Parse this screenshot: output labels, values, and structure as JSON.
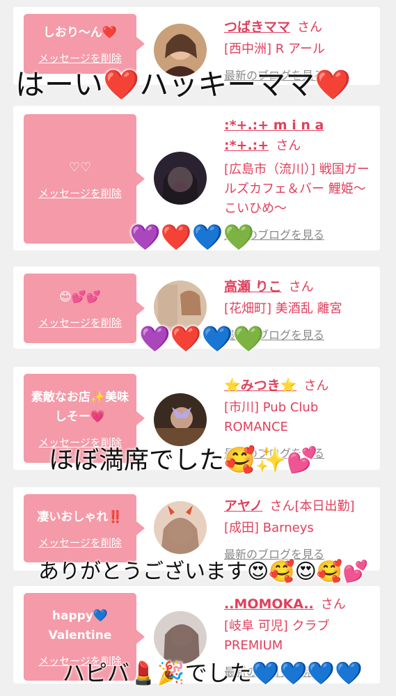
{
  "cards": [
    {
      "message": "しおり〜ん❤️",
      "delete_label": "メッセージを削除",
      "name": "つばきママ",
      "honorific": "さん",
      "shop": "[西中洲] R アール",
      "blog_label": "最新のブログを見る"
    },
    {
      "message": "♡♡",
      "delete_label": "メッセージを削除",
      "name": ":*+.:+ m i n a :*+.:+",
      "honorific": "さん",
      "shop": "[広島市（流川）] 戦国ガールズカフェ＆バー 鯉姫〜こいひめ〜",
      "blog_label": "最新のブログを見る"
    },
    {
      "message": "😊💕💕",
      "delete_label": "メッセージを削除",
      "name": "高瀬 りこ",
      "honorific": "さん",
      "shop": "[花畑町] 美酒乱 離宮",
      "blog_label": "最新のブログを見る"
    },
    {
      "message": "素敵なお店✨美味しそー💗",
      "delete_label": "メッセージを削除",
      "name": "⭐みつき⭐",
      "honorific": "さん",
      "shop": "[市川] Pub Club ROMANCE",
      "blog_label": "最新のブログを見る"
    },
    {
      "message": "凄いおしゃれ‼️",
      "delete_label": "メッセージを削除",
      "name": "アヤノ",
      "honorific": "さん[本日出勤]",
      "shop": "[成田] Barneys",
      "blog_label": "最新のブログを見る"
    },
    {
      "message": "happy💙 Valentine",
      "delete_label": "メッセージを削除",
      "name": "..MOMOKA..",
      "honorific": "さん",
      "shop": "[岐阜 可児] クラブ PREMIUM",
      "blog_label": "最新のブログを見る"
    }
  ],
  "overlays": {
    "line1": "はーい❤️ハッキーママ❤️",
    "hearts1": "💜❤️💙💚",
    "hearts2": "💜❤️💙💚",
    "line2": "ほぼ満席でした🥰✨💕",
    "line3": "ありがとうございます😍🥰😍🥰💕",
    "line4": "ハピバ💄🎉でした💙💙💙💙"
  },
  "colors": {
    "bubble": "#f49aa8",
    "accent": "#e0405c",
    "background": "#f0f0f0"
  }
}
